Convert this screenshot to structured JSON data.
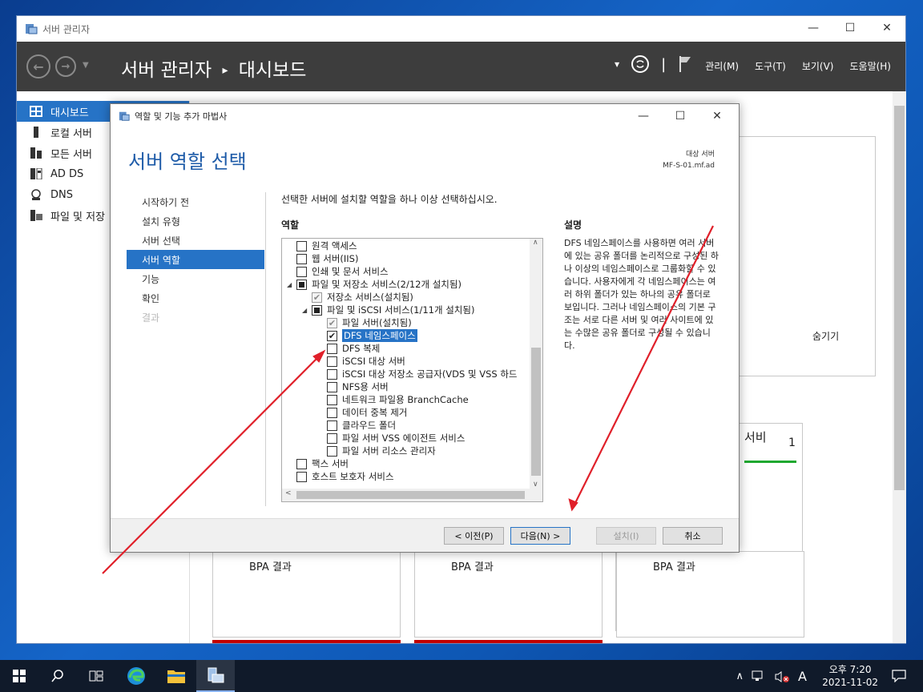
{
  "server_manager": {
    "window_title": "서버 관리자",
    "breadcrumb_root": "서버 관리자",
    "breadcrumb_sep": "▸",
    "breadcrumb_page": "대시보드",
    "menus": [
      "관리(M)",
      "도구(T)",
      "보기(V)",
      "도움말(H)"
    ],
    "sidebar": [
      {
        "label": "대시보드",
        "icon": "dashboard-icon",
        "selected": true
      },
      {
        "label": "로컬 서버",
        "icon": "server-icon"
      },
      {
        "label": "모든 서버",
        "icon": "servers-icon"
      },
      {
        "label": "AD DS",
        "icon": "ad-ds-icon"
      },
      {
        "label": "DNS",
        "icon": "dns-icon"
      },
      {
        "label": "파일 및 저장",
        "icon": "file-storage-icon"
      }
    ],
    "hide_label": "숨기기",
    "tile_label": "서비",
    "tile_count": "1",
    "bpa_labels": [
      "BPA 결과",
      "BPA 결과",
      "BPA 결과"
    ]
  },
  "dialog": {
    "title": "역할 및 기능 추가 마법사",
    "heading": "서버 역할 선택",
    "target_label": "대상 서버",
    "target_server": "MF-S-01.mf.ad",
    "steps": [
      {
        "label": "시작하기 전"
      },
      {
        "label": "설치 유형"
      },
      {
        "label": "서버 선택"
      },
      {
        "label": "서버 역할",
        "selected": true
      },
      {
        "label": "기능"
      },
      {
        "label": "확인"
      },
      {
        "label": "결과",
        "disabled": true
      }
    ],
    "instruction": "선택한 서버에 설치할 역할을 하나 이상 선택하십시오.",
    "roles_heading": "역할",
    "description_heading": "설명",
    "description": "DFS 네임스페이스를 사용하면 여러 서버에 있는 공유 폴더를 논리적으로 구성된 하나 이상의 네임스페이스로 그룹화할 수 있습니다. 사용자에게 각 네임스페이스는 여러 하위 폴더가 있는 하나의 공유 폴더로 보입니다. 그러나 네임스페이스의 기본 구조는 서로 다른 서버 및 여러 사이트에 있는 수많은 공유 폴더로 구성될 수 있습니다.",
    "roles": [
      {
        "label": "원격 액세스",
        "indent": 0,
        "state": "unchecked"
      },
      {
        "label": "웹 서버(IIS)",
        "indent": 0,
        "state": "unchecked"
      },
      {
        "label": "인쇄 및 문서 서비스",
        "indent": 0,
        "state": "unchecked"
      },
      {
        "label": "파일 및 저장소 서비스(2/12개 설치됨)",
        "indent": 0,
        "state": "partial",
        "expander": "◢"
      },
      {
        "label": "저장소 서비스(설치됨)",
        "indent": 1,
        "state": "checked-disabled"
      },
      {
        "label": "파일 및 iSCSI 서비스(1/11개 설치됨)",
        "indent": 1,
        "state": "partial",
        "expander": "◢"
      },
      {
        "label": "파일 서버(설치됨)",
        "indent": 2,
        "state": "checked-disabled"
      },
      {
        "label": "DFS 네임스페이스",
        "indent": 2,
        "state": "checked",
        "highlight": true
      },
      {
        "label": "DFS 복제",
        "indent": 2,
        "state": "unchecked"
      },
      {
        "label": "iSCSI 대상 서버",
        "indent": 2,
        "state": "unchecked"
      },
      {
        "label": "iSCSI 대상 저장소 공급자(VDS 및 VSS 하드",
        "indent": 2,
        "state": "unchecked"
      },
      {
        "label": "NFS용 서버",
        "indent": 2,
        "state": "unchecked"
      },
      {
        "label": "네트워크 파일용 BranchCache",
        "indent": 2,
        "state": "unchecked"
      },
      {
        "label": "데이터 중복 제거",
        "indent": 2,
        "state": "unchecked"
      },
      {
        "label": "클라우드 폴더",
        "indent": 2,
        "state": "unchecked"
      },
      {
        "label": "파일 서버 VSS 에이전트 서비스",
        "indent": 2,
        "state": "unchecked"
      },
      {
        "label": "파일 서버 리소스 관리자",
        "indent": 2,
        "state": "unchecked"
      },
      {
        "label": "팩스 서버",
        "indent": 0,
        "state": "unchecked"
      },
      {
        "label": "호스트 보호자 서비스",
        "indent": 0,
        "state": "unchecked"
      }
    ],
    "buttons": {
      "prev": "< 이전(P)",
      "next": "다음(N) >",
      "install": "설치(I)",
      "cancel": "취소"
    }
  },
  "taskbar": {
    "clock_period_time": "오후 7:20",
    "clock_date": "2021-11-02",
    "ime": "A",
    "tray_chevron": "∧"
  },
  "colors": {
    "accent": "#2673c6",
    "annotation_arrow": "#e0202a",
    "header_bg": "#3d3d3d"
  }
}
